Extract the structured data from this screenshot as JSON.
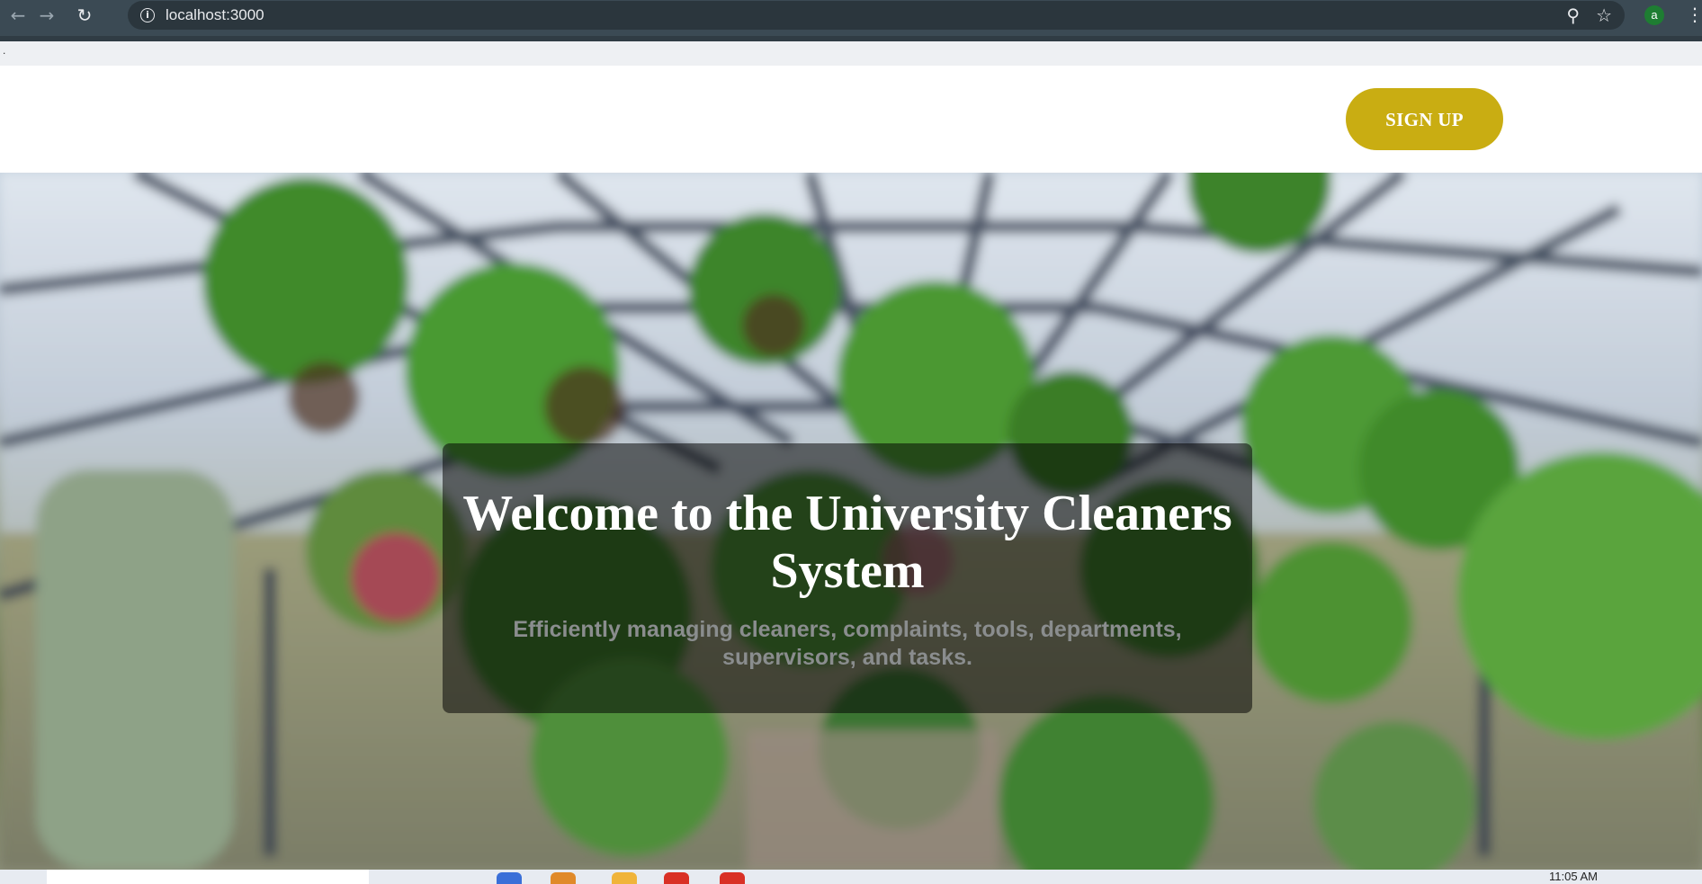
{
  "browser": {
    "url": "localhost:3000",
    "back_icon": "arrow-left-icon",
    "forward_icon": "arrow-right-icon",
    "reload_icon": "reload-icon",
    "site_info_icon": "info-icon",
    "zoom_icon": "zoom-icon",
    "bookmark_icon": "star-icon",
    "profile_initial": "a",
    "menu_icon": "kebab-menu-icon"
  },
  "page": {
    "top_strip_text": "."
  },
  "header": {
    "signup_label": "SIGN UP",
    "signup_color": "#c9ad12"
  },
  "hero": {
    "title": "Welcome to the University Cleaners System",
    "subtitle": "Efficiently managing cleaners, complaints, tools, departments, supervisors, and tasks."
  },
  "taskbar": {
    "clock": "11:05 AM"
  }
}
